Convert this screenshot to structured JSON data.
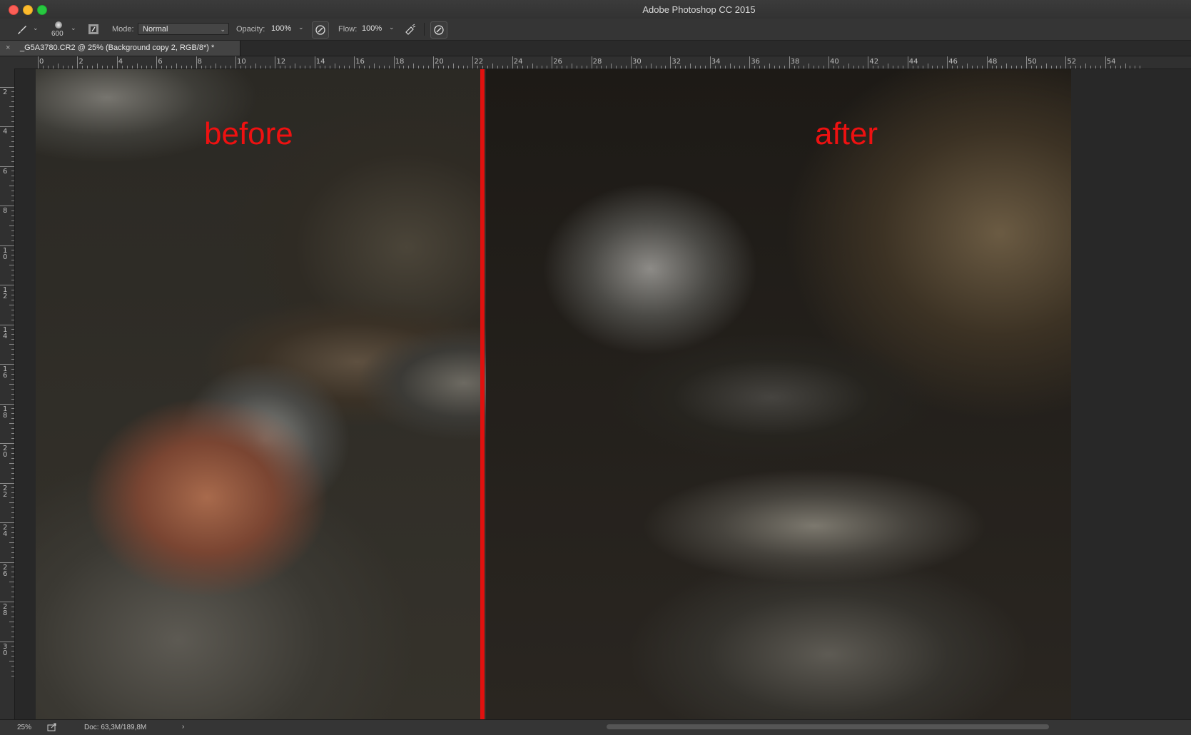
{
  "window": {
    "title": "Adobe Photoshop CC 2015"
  },
  "options_bar": {
    "brush_size": "600",
    "mode_label": "Mode:",
    "mode_value": "Normal",
    "opacity_label": "Opacity:",
    "opacity_value": "100%",
    "flow_label": "Flow:",
    "flow_value": "100%"
  },
  "document_tab": {
    "close_glyph": "×",
    "name": "_G5A3780.CR2 @ 25% (Background copy 2, RGB/8*) *"
  },
  "ruler": {
    "horizontal_labels": [
      "0",
      "2",
      "4",
      "6",
      "8",
      "10",
      "12",
      "14",
      "16",
      "18",
      "20",
      "22",
      "24",
      "26",
      "28",
      "30",
      "32",
      "34",
      "36",
      "38",
      "40",
      "42",
      "44",
      "46",
      "48",
      "50",
      "52",
      "54"
    ],
    "vertical_labels": [
      "2",
      "4",
      "6",
      "8",
      "10",
      "12",
      "14",
      "16",
      "18",
      "20",
      "22",
      "24",
      "26",
      "28",
      "30"
    ]
  },
  "canvas": {
    "before_label": "before",
    "after_label": "after",
    "divider_color": "#e0110f",
    "label_color": "#ee1111"
  },
  "status_bar": {
    "zoom": "25%",
    "doc_info": "Doc: 63,3M/189,8M",
    "arrow": "›"
  }
}
